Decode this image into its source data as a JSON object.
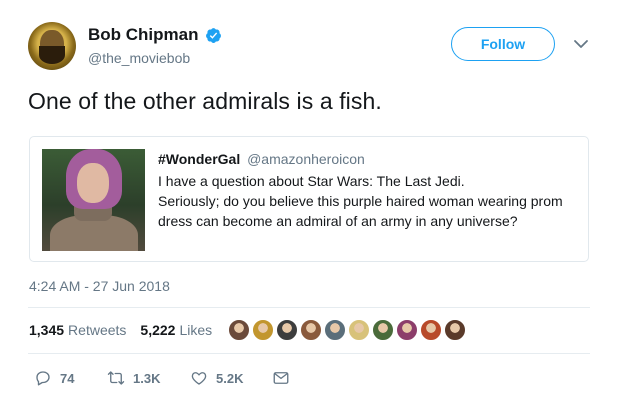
{
  "author": {
    "name": "Bob Chipman",
    "handle": "@the_moviebob",
    "verified": true
  },
  "follow_label": "Follow",
  "tweet_text": "One of the other admirals is a fish.",
  "quoted": {
    "name": "#WonderGal",
    "handle": "@amazonheroicon",
    "lines": [
      "I have a question about Star Wars: The Last Jedi.",
      "Seriously; do you believe this purple haired woman wearing prom",
      "dress can become an admiral of an army in any universe?"
    ]
  },
  "timestamp": "4:24 AM - 27 Jun 2018",
  "stats": {
    "retweets_count": "1,345",
    "retweets_label": "Retweets",
    "likes_count": "5,222",
    "likes_label": "Likes"
  },
  "liker_avatar_colors": [
    "#6b4a3a",
    "#c2962e",
    "#3d3d3d",
    "#8a5a3c",
    "#5a6e7a",
    "#d8c27a",
    "#4a6b3a",
    "#8c3d6a",
    "#b84a2a",
    "#5a3a2a"
  ],
  "actions": {
    "replies": "74",
    "retweets": "1.3K",
    "likes": "5.2K"
  },
  "colors": {
    "accent": "#1da1f2",
    "secondary_text": "#657786"
  },
  "icons": [
    "verified-badge-icon",
    "chevron-down-icon",
    "reply-icon",
    "retweet-icon",
    "heart-icon",
    "direct-message-icon"
  ]
}
